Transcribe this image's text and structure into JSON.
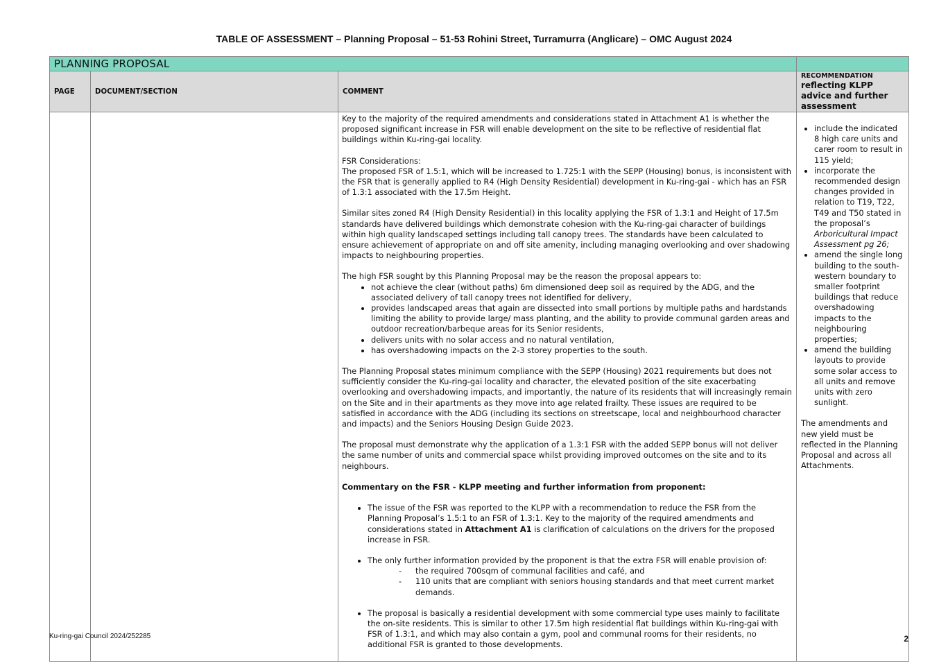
{
  "document": {
    "title": "TABLE OF ASSESSMENT – Planning Proposal – 51-53 Rohini Street, Turramurra (Anglicare) – OMC August 2024"
  },
  "table": {
    "section_label": "PLANNING PROPOSAL",
    "headers": {
      "page": "PAGE",
      "document_section": "DOCUMENT/SECTION",
      "comment": "COMMENT",
      "recommendation_top": "RECOMMENDATION",
      "recommendation_rest": "reflecting KLPP advice and further assessment"
    },
    "comment": {
      "p1": "Key to the majority of the required amendments and considerations stated in Attachment A1 is whether the proposed significant increase in FSR will enable development on the site to be reflective of residential flat buildings within Ku-ring-gai locality.",
      "p2_heading": "FSR Considerations:",
      "p2_body": "The proposed FSR of 1.5:1, which will be increased to 1.725:1 with the SEPP (Housing) bonus, is inconsistent with the FSR that is generally applied to R4 (High Density Residential) development in Ku-ring-gai - which has an FSR of 1.3:1 associated with the 17.5m Height.",
      "p3": "Similar sites zoned R4 (High Density Residential) in this locality applying the FSR of 1.3:1 and Height of 17.5m standards have delivered buildings which demonstrate cohesion with the Ku-ring-gai character of buildings within high quality landscaped settings including tall canopy trees. The standards have been calculated to ensure achievement of appropriate on and off site amenity, including managing overlooking and over shadowing impacts to neighbouring properties.",
      "p4_intro": "The high FSR sought by this Planning Proposal may be the reason the proposal appears to:",
      "p4_bullets": [
        "not achieve the clear (without paths) 6m dimensioned deep soil as required by the ADG, and the associated delivery of tall canopy trees not identified for delivery,",
        "provides landscaped areas that again are dissected into small portions by multiple paths and hardstands limiting the ability to provide large/ mass planting, and the ability to provide communal garden areas and outdoor recreation/barbeque areas for its Senior residents,",
        "delivers units with no solar access and no natural ventilation,",
        "has overshadowing impacts on the 2-3 storey properties to the south."
      ],
      "p5": "The Planning Proposal states minimum compliance with the SEPP (Housing) 2021 requirements but does not sufficiently consider the Ku-ring-gai locality and character, the elevated position of the site exacerbating overlooking and overshadowing impacts, and importantly, the nature of its residents that will increasingly remain on the Site and in their apartments as they move into age related frailty. These issues are required to be satisfied in accordance with the ADG (including its sections on streetscape, local and neighbourhood character and impacts) and the Seniors Housing Design Guide 2023.",
      "p6": "The proposal must demonstrate why the application of a 1.3:1 FSR with the added SEPP bonus will not deliver the same number of units and commercial space whilst providing improved outcomes on the site and to its neighbours.",
      "p7_heading": "Commentary on the FSR - KLPP meeting and further information from proponent:",
      "p7_b1_pre": "The issue of the FSR was reported to the KLPP with a recommendation to reduce the FSR from the Planning Proposal’s 1.5:1 to an FSR of 1.3:1. Key to the majority of the required amendments and considerations stated in ",
      "p7_b1_bold": "Attachment A1",
      "p7_b1_post": " is clarification of calculations on the drivers for the proposed increase in FSR.",
      "p7_b2": "The only further information provided by the proponent is that the extra FSR will enable provision of:",
      "p7_b2_dashes": [
        "the required 700sqm of communal facilities and café, and",
        "110 units that are compliant with seniors housing standards and that meet current market demands."
      ],
      "p7_b3": "The proposal is basically a residential development with some commercial type uses mainly to facilitate the on-site residents. This is similar to other 17.5m high residential flat buildings within Ku-ring-gai with FSR of 1.3:1, and which may also contain a gym, pool and communal rooms for their residents, no additional FSR is granted to those developments."
    },
    "recommendation": {
      "bullet1": "include the indicated 8 high care units and carer room to result in 115 yield;",
      "bullet2_pre": "incorporate the recommended design changes provided in relation to T19, T22, T49 and T50 stated in the proposal’s ",
      "bullet2_italic": "Arboricultural Impact Assessment",
      "bullet2_post": " pg 26;",
      "bullet3": "amend the single long building to the south-western boundary to smaller footprint buildings that reduce overshadowing impacts to the neighbouring properties;",
      "bullet4": "amend the building layouts to provide some solar access to all units and remove units with zero sunlight.",
      "closing": "The amendments and new yield must be reflected in the Planning Proposal and across all Attachments."
    }
  },
  "footer": {
    "reference": "Ku-ring-gai Council 2024/252285",
    "page_number": "2"
  }
}
